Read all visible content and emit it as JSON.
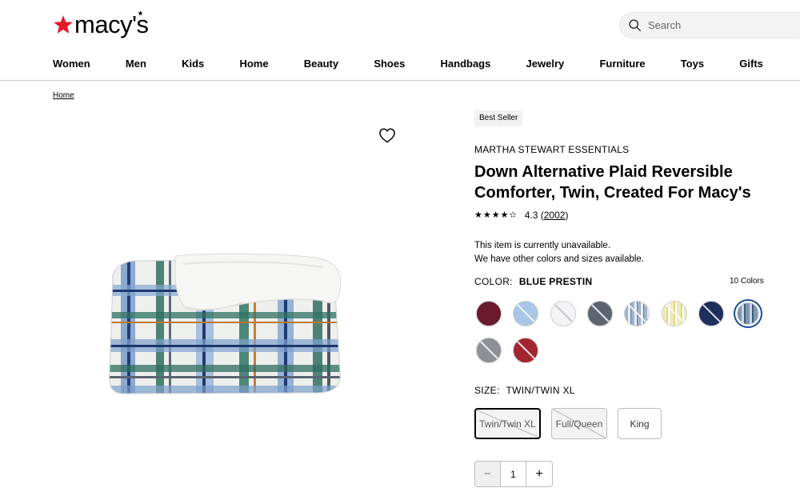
{
  "header": {
    "logo_text": "macy's",
    "search_placeholder": "Search"
  },
  "nav": {
    "items": [
      "Women",
      "Men",
      "Kids",
      "Home",
      "Beauty",
      "Shoes",
      "Handbags",
      "Jewelry",
      "Furniture",
      "Toys",
      "Gifts"
    ]
  },
  "breadcrumb": {
    "home": "Home"
  },
  "product": {
    "badge": "Best Seller",
    "brand": "MARTHA STEWART ESSENTIALS",
    "title": "Down Alternative Plaid Reversible Comforter, Twin, Created For Macy's",
    "rating_value": "4.3",
    "rating_count": "2002",
    "rating_stars": 4.3,
    "unavailable_line1": "This item is currently unavailable.",
    "unavailable_line2": "We have other colors and sizes available.",
    "color_label": "COLOR:",
    "color_value": "BLUE PRESTIN",
    "color_count": "10 Colors",
    "size_label": "SIZE:",
    "size_value": "TWIN/TWIN XL",
    "sizes": [
      {
        "label": "Twin/Twin XL",
        "state": "selected-unavailable"
      },
      {
        "label": "Full/Queen",
        "state": "unavailable"
      },
      {
        "label": "King",
        "state": "available"
      }
    ],
    "quantity": "1",
    "minus": "−",
    "plus": "+"
  },
  "swatch_colors": [
    "#6b1a2e",
    "#a9c6e8",
    "#f4f4f6",
    "#5c6470",
    "#9fb4c8",
    "#eeeac4",
    "#1e2f5e",
    "#7e98ae",
    "#8d9195",
    "#a3252f"
  ],
  "colors": {
    "accent_red": "#e21a2c",
    "selected_ring": "#1a4f9c"
  }
}
